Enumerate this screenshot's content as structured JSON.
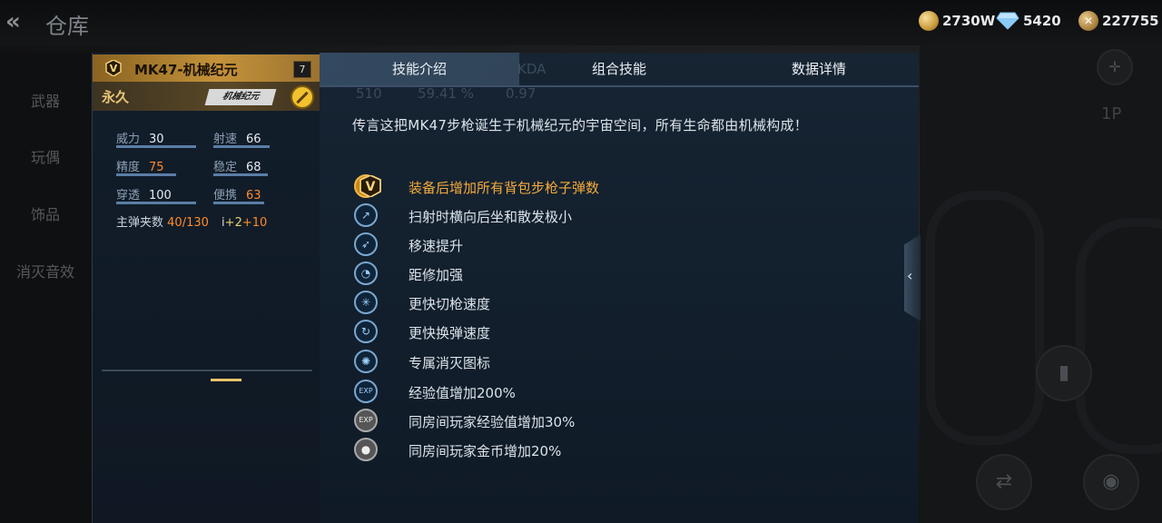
{
  "header": {
    "title": "仓库"
  },
  "currencies": [
    {
      "value": "2730W",
      "icon": "gold-coin-plus-icon"
    },
    {
      "value": "5420",
      "icon": "diamond-icon"
    },
    {
      "value": "227755",
      "icon": "crossed-swords-coin-icon"
    }
  ],
  "sidebar": {
    "items": [
      "武器",
      "玩偶",
      "饰品",
      "消灭音效"
    ]
  },
  "right_area": {
    "label": "1P"
  },
  "weapon": {
    "name": "MK47-机械纪元",
    "level": "7",
    "duration": "永久",
    "brand": "机械纪元",
    "stats": [
      {
        "label": "威力",
        "value": "30",
        "highlight": false
      },
      {
        "label": "射速",
        "value": "66",
        "highlight": false
      },
      {
        "label": "精度",
        "value": "75",
        "highlight": true
      },
      {
        "label": "稳定",
        "value": "68",
        "highlight": false
      },
      {
        "label": "穿透",
        "value": "100",
        "highlight": false
      },
      {
        "label": "便携",
        "value": "63",
        "highlight": true
      }
    ],
    "ammo_label": "主弹夹数",
    "ammo_value": "40/130",
    "ammo_bonus_a": "+2",
    "ammo_bonus_b": "+10"
  },
  "ghost_header": {
    "c1": "510",
    "c2": "59.41 %",
    "c3": "0.97",
    "c4": "KDA"
  },
  "tabs": [
    {
      "label": "技能介绍",
      "active": true
    },
    {
      "label": "组合技能",
      "active": false
    },
    {
      "label": "数据详情",
      "active": false
    }
  ],
  "description": "传言这把MK47步枪诞生于机械纪元的宇宙空间，所有生命都由机械构成！",
  "skills": [
    {
      "text": "装备后增加所有背包步枪子弹数",
      "icon": "rifle-ammo-icon",
      "style": "gold"
    },
    {
      "text": "扫射时横向后坐和散发极小",
      "icon": "recoil-icon",
      "style": "blue"
    },
    {
      "text": "移速提升",
      "icon": "running-man-icon",
      "style": "blue"
    },
    {
      "text": "距修加强",
      "icon": "range-gauge-icon",
      "style": "blue"
    },
    {
      "text": "更快切枪速度",
      "icon": "weapon-switch-icon",
      "style": "blue"
    },
    {
      "text": "更快换弹速度",
      "icon": "reload-icon",
      "style": "blue"
    },
    {
      "text": "专属消灭图标",
      "icon": "kill-icon",
      "style": "blue"
    },
    {
      "text": "经验值增加200%",
      "icon": "exp-plus-icon",
      "style": "blue"
    },
    {
      "text": "同房间玩家经验值增加30%",
      "icon": "room-exp-icon",
      "style": "gray"
    },
    {
      "text": "同房间玩家金币增加20%",
      "icon": "room-coin-icon",
      "style": "gray"
    }
  ]
}
